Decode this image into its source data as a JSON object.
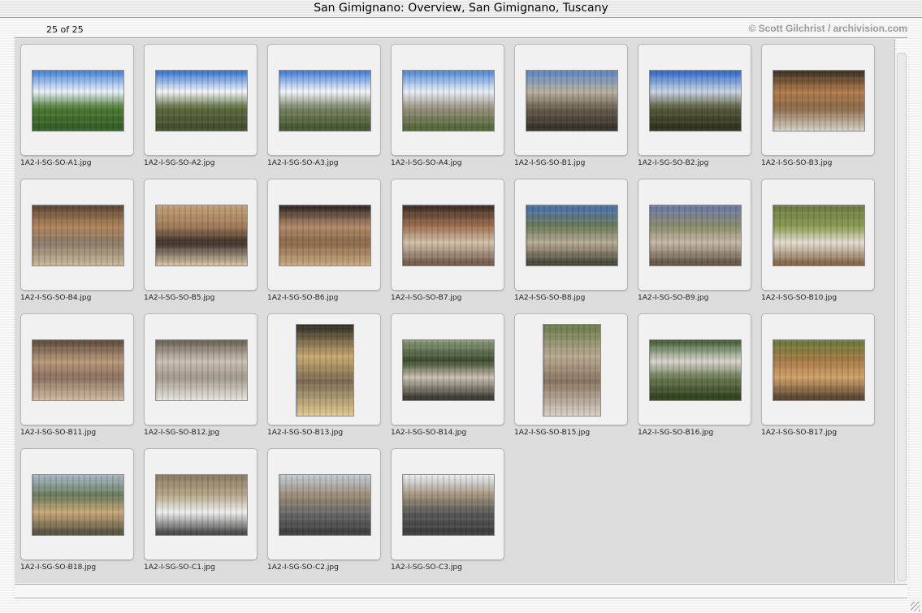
{
  "window": {
    "title": "San Gimignano: Overview, San Gimignano, Tuscany"
  },
  "header": {
    "counter": "25 of 25",
    "copyright": "© Scott Gilchrist / archivision.com"
  },
  "thumbnails": [
    {
      "filename": "1A2-I-SG-SO-A1.jpg",
      "orientation": "landscape",
      "colors": [
        "#3f7fd8",
        "#e9f0f8",
        "#4d7a34",
        "#2f5a23"
      ]
    },
    {
      "filename": "1A2-I-SG-SO-A2.jpg",
      "orientation": "landscape",
      "colors": [
        "#2f6fd2",
        "#f2f4f6",
        "#5b6b3e",
        "#3d4a2a"
      ]
    },
    {
      "filename": "1A2-I-SG-SO-A3.jpg",
      "orientation": "landscape",
      "colors": [
        "#3b78d6",
        "#f3f5f8",
        "#788466",
        "#3d5028"
      ]
    },
    {
      "filename": "1A2-I-SG-SO-A4.jpg",
      "orientation": "landscape",
      "colors": [
        "#4a86d6",
        "#e8eef5",
        "#9a9280",
        "#4a6030"
      ]
    },
    {
      "filename": "1A2-I-SG-SO-B1.jpg",
      "orientation": "landscape",
      "colors": [
        "#5a86c6",
        "#b8b0a0",
        "#6a6050",
        "#2e2a22"
      ]
    },
    {
      "filename": "1A2-I-SG-SO-B2.jpg",
      "orientation": "landscape",
      "colors": [
        "#2a64c8",
        "#c8d4e4",
        "#5a5a3a",
        "#2a2a1a"
      ]
    },
    {
      "filename": "1A2-I-SG-SO-B3.jpg",
      "orientation": "landscape",
      "colors": [
        "#3a2e22",
        "#b07a4a",
        "#8a6a48",
        "#d4cfc4"
      ]
    },
    {
      "filename": "1A2-I-SG-SO-B4.jpg",
      "orientation": "landscape",
      "colors": [
        "#5a4432",
        "#b0845a",
        "#8a7a68",
        "#c8b89a"
      ]
    },
    {
      "filename": "1A2-I-SG-SO-B5.jpg",
      "orientation": "landscape",
      "colors": [
        "#c4a078",
        "#a07a58",
        "#3a3028",
        "#d8c4a8"
      ]
    },
    {
      "filename": "1A2-I-SG-SO-B6.jpg",
      "orientation": "landscape",
      "colors": [
        "#2a2420",
        "#b08868",
        "#8a6848",
        "#c8a880"
      ]
    },
    {
      "filename": "1A2-I-SG-SO-B7.jpg",
      "orientation": "landscape",
      "colors": [
        "#3a2a22",
        "#a07050",
        "#d0c0a8",
        "#6a5040"
      ]
    },
    {
      "filename": "1A2-I-SG-SO-B8.jpg",
      "orientation": "landscape",
      "colors": [
        "#4a70b0",
        "#6a7a58",
        "#b8aa94",
        "#3a3a2e"
      ]
    },
    {
      "filename": "1A2-I-SG-SO-B9.jpg",
      "orientation": "landscape",
      "colors": [
        "#6a7aa8",
        "#8a8a6a",
        "#c4b8a4",
        "#5a4a3a"
      ]
    },
    {
      "filename": "1A2-I-SG-SO-B10.jpg",
      "orientation": "landscape",
      "colors": [
        "#6a7a42",
        "#8a9a52",
        "#e4dcd0",
        "#7a5a3a"
      ]
    },
    {
      "filename": "1A2-I-SG-SO-B11.jpg",
      "orientation": "landscape",
      "colors": [
        "#5a4a3a",
        "#b89878",
        "#8a7060",
        "#d0bca0"
      ]
    },
    {
      "filename": "1A2-I-SG-SO-B12.jpg",
      "orientation": "landscape",
      "colors": [
        "#6a6050",
        "#c8c0b4",
        "#a09888",
        "#e8e4de"
      ]
    },
    {
      "filename": "1A2-I-SG-SO-B13.jpg",
      "orientation": "portrait",
      "colors": [
        "#2a2a22",
        "#c8a870",
        "#7a6a50",
        "#e0c890"
      ]
    },
    {
      "filename": "1A2-I-SG-SO-B14.jpg",
      "orientation": "landscape",
      "colors": [
        "#8a9a78",
        "#3a4a2a",
        "#c8c0b0",
        "#2a2a22"
      ]
    },
    {
      "filename": "1A2-I-SG-SO-B15.jpg",
      "orientation": "portrait",
      "colors": [
        "#6a7a4a",
        "#b8a890",
        "#8a7460",
        "#d8d0c4"
      ]
    },
    {
      "filename": "1A2-I-SG-SO-B16.jpg",
      "orientation": "landscape",
      "colors": [
        "#3a5a2a",
        "#d8d4cc",
        "#6a7a52",
        "#2a3a1a"
      ]
    },
    {
      "filename": "1A2-I-SG-SO-B17.jpg",
      "orientation": "landscape",
      "colors": [
        "#6a7a3a",
        "#a87a48",
        "#d0a068",
        "#4a3a2a"
      ]
    },
    {
      "filename": "1A2-I-SG-SO-B18.jpg",
      "orientation": "landscape",
      "colors": [
        "#a8b8c8",
        "#6a7a5a",
        "#c8a878",
        "#4a4a3a"
      ]
    },
    {
      "filename": "1A2-I-SG-SO-C1.jpg",
      "orientation": "landscape",
      "colors": [
        "#8a7a62",
        "#b8a88a",
        "#eeeeee",
        "#3a3a38"
      ]
    },
    {
      "filename": "1A2-I-SG-SO-C2.jpg",
      "orientation": "landscape",
      "colors": [
        "#c0ccd8",
        "#9a8a72",
        "#6a6a6a",
        "#3a3a3a"
      ]
    },
    {
      "filename": "1A2-I-SG-SO-C3.jpg",
      "orientation": "landscape",
      "colors": [
        "#e8eef4",
        "#a09078",
        "#5a5a5a",
        "#3a3a3a"
      ]
    }
  ]
}
